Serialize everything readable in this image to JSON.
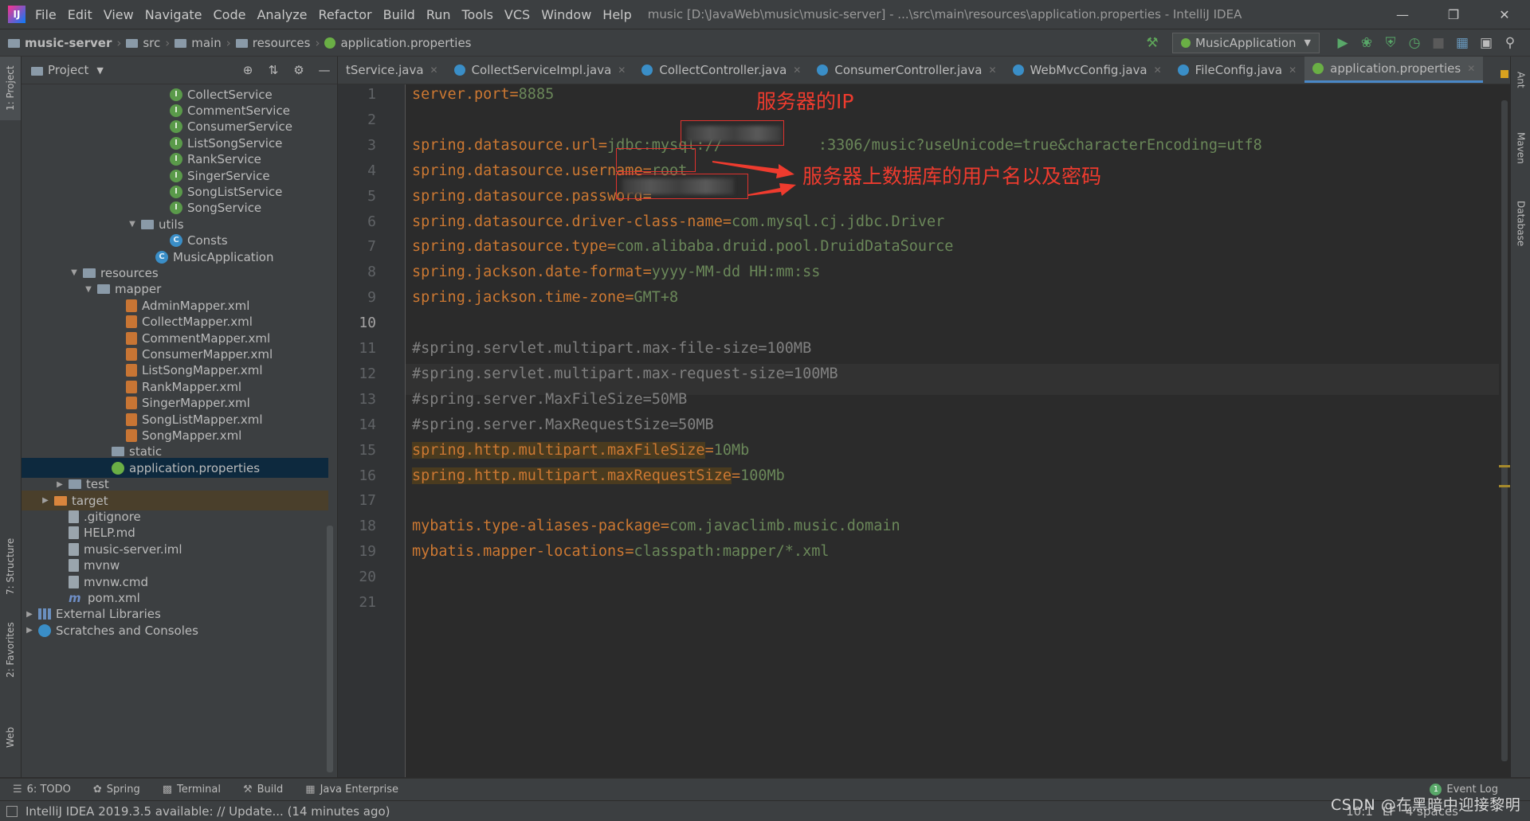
{
  "menubar": {
    "menus": [
      "File",
      "Edit",
      "View",
      "Navigate",
      "Code",
      "Analyze",
      "Refactor",
      "Build",
      "Run",
      "Tools",
      "VCS",
      "Window",
      "Help"
    ],
    "window_title": "music [D:\\JavaWeb\\music\\music-server] - ...\\src\\main\\resources\\application.properties - IntelliJ IDEA"
  },
  "navbar": {
    "breadcrumbs": [
      "music-server",
      "src",
      "main",
      "resources",
      "application.properties"
    ],
    "run_config": "MusicApplication"
  },
  "project_panel": {
    "title": "Project",
    "tree": [
      {
        "label": "CollectService",
        "icon": "interface-icon"
      },
      {
        "label": "CommentService",
        "icon": "interface-icon"
      },
      {
        "label": "ConsumerService",
        "icon": "interface-icon"
      },
      {
        "label": "ListSongService",
        "icon": "interface-icon"
      },
      {
        "label": "RankService",
        "icon": "interface-icon"
      },
      {
        "label": "SingerService",
        "icon": "interface-icon"
      },
      {
        "label": "SongListService",
        "icon": "interface-icon"
      },
      {
        "label": "SongService",
        "icon": "interface-icon"
      },
      {
        "label": "utils",
        "icon": "folder-icon"
      },
      {
        "label": "Consts",
        "icon": "class-icon"
      },
      {
        "label": "MusicApplication",
        "icon": "spring-boot-class-icon"
      },
      {
        "label": "resources",
        "icon": "resources-folder-icon"
      },
      {
        "label": "mapper",
        "icon": "folder-icon"
      },
      {
        "label": "AdminMapper.xml",
        "icon": "xml-file-icon"
      },
      {
        "label": "CollectMapper.xml",
        "icon": "xml-file-icon"
      },
      {
        "label": "CommentMapper.xml",
        "icon": "xml-file-icon"
      },
      {
        "label": "ConsumerMapper.xml",
        "icon": "xml-file-icon"
      },
      {
        "label": "ListSongMapper.xml",
        "icon": "xml-file-icon"
      },
      {
        "label": "RankMapper.xml",
        "icon": "xml-file-icon"
      },
      {
        "label": "SingerMapper.xml",
        "icon": "xml-file-icon"
      },
      {
        "label": "SongListMapper.xml",
        "icon": "xml-file-icon"
      },
      {
        "label": "SongMapper.xml",
        "icon": "xml-file-icon"
      },
      {
        "label": "static",
        "icon": "folder-icon"
      },
      {
        "label": "application.properties",
        "icon": "properties-file-icon"
      },
      {
        "label": "test",
        "icon": "folder-icon"
      },
      {
        "label": "target",
        "icon": "excluded-folder-icon"
      },
      {
        "label": ".gitignore",
        "icon": "file-icon"
      },
      {
        "label": "HELP.md",
        "icon": "markdown-file-icon"
      },
      {
        "label": "music-server.iml",
        "icon": "iml-file-icon"
      },
      {
        "label": "mvnw",
        "icon": "file-icon"
      },
      {
        "label": "mvnw.cmd",
        "icon": "file-icon"
      },
      {
        "label": "pom.xml",
        "icon": "maven-icon"
      },
      {
        "label": "External Libraries",
        "icon": "library-icon"
      },
      {
        "label": "Scratches and Consoles",
        "icon": "scratches-icon"
      }
    ]
  },
  "tabs": [
    {
      "label": "tService.java"
    },
    {
      "label": "CollectServiceImpl.java"
    },
    {
      "label": "CollectController.java"
    },
    {
      "label": "ConsumerController.java"
    },
    {
      "label": "WebMvcConfig.java"
    },
    {
      "label": "FileConfig.java"
    },
    {
      "label": "application.properties"
    }
  ],
  "editor": {
    "line_numbers": [
      "1",
      "2",
      "3",
      "4",
      "5",
      "6",
      "7",
      "8",
      "9",
      "10",
      "11",
      "12",
      "13",
      "14",
      "15",
      "16",
      "17",
      "18",
      "19",
      "20",
      "21"
    ],
    "current_line": "10",
    "lines": [
      {
        "key": "server.port",
        "eq": "=",
        "val": "8885"
      },
      {
        "key": "",
        "eq": "",
        "val": ""
      },
      {
        "key": "spring.datasource.url",
        "eq": "=",
        "val": "jdbc:mysql://",
        "val2": ":3306/music?useUnicode=true&characterEncoding=utf8"
      },
      {
        "key": "spring.datasource.username",
        "eq": "=",
        "val": "root"
      },
      {
        "key": "spring.datasource.password",
        "eq": "=",
        "val": ""
      },
      {
        "key": "spring.datasource.driver-class-name",
        "eq": "=",
        "val": "com.mysql.cj.jdbc.Driver"
      },
      {
        "key": "spring.datasource.type",
        "eq": "=",
        "val": "com.alibaba.druid.pool.DruidDataSource"
      },
      {
        "key": "spring.jackson.date-format",
        "eq": "=",
        "val": "yyyy-MM-dd HH:mm:ss"
      },
      {
        "key": "spring.jackson.time-zone",
        "eq": "=",
        "val": "GMT+8"
      },
      {
        "key": "",
        "eq": "",
        "val": ""
      },
      {
        "comment": "#spring.servlet.multipart.max-file-size=100MB"
      },
      {
        "comment": "#spring.servlet.multipart.max-request-size=100MB"
      },
      {
        "comment": "#spring.server.MaxFileSize=50MB"
      },
      {
        "comment": "#spring.server.MaxRequestSize=50MB"
      },
      {
        "key": "spring.http.multipart.maxFileSize",
        "eq": "=",
        "val": "10Mb"
      },
      {
        "key": "spring.http.multipart.maxRequestSize",
        "eq": "=",
        "val": "100Mb"
      },
      {
        "key": "",
        "eq": "",
        "val": ""
      },
      {
        "key": "mybatis.type-aliases-package",
        "eq": "=",
        "val": "com.javaclimb.music.domain"
      },
      {
        "key": "mybatis.mapper-locations",
        "eq": "=",
        "val": "classpath:mapper/*.xml"
      }
    ]
  },
  "annotations": {
    "ip_label": "服务器的IP",
    "credentials_label": "服务器上数据库的用户名以及密码"
  },
  "left_tool_tabs": [
    "1: Project",
    "7: Structure",
    "2: Favorites",
    "Web"
  ],
  "right_tool_tabs": [
    "Ant",
    "Maven",
    "Database"
  ],
  "bottom_tools": [
    "6: TODO",
    "Spring",
    "Terminal",
    "Build",
    "Java Enterprise"
  ],
  "event_log": {
    "label": "Event Log",
    "count": "1"
  },
  "status": {
    "message": "IntelliJ IDEA 2019.3.5 available: // Update... (14 minutes ago)",
    "caret": "10:1",
    "encoding_hint": "LF",
    "indent": "4 spaces"
  },
  "watermark": "CSDN @在黑暗中迎接黎明",
  "colors": {
    "key": "#cc7832",
    "value": "#6a8759",
    "comment": "#808080",
    "annotation_red": "#ee3b2e",
    "accent_blue": "#4a88c7"
  }
}
